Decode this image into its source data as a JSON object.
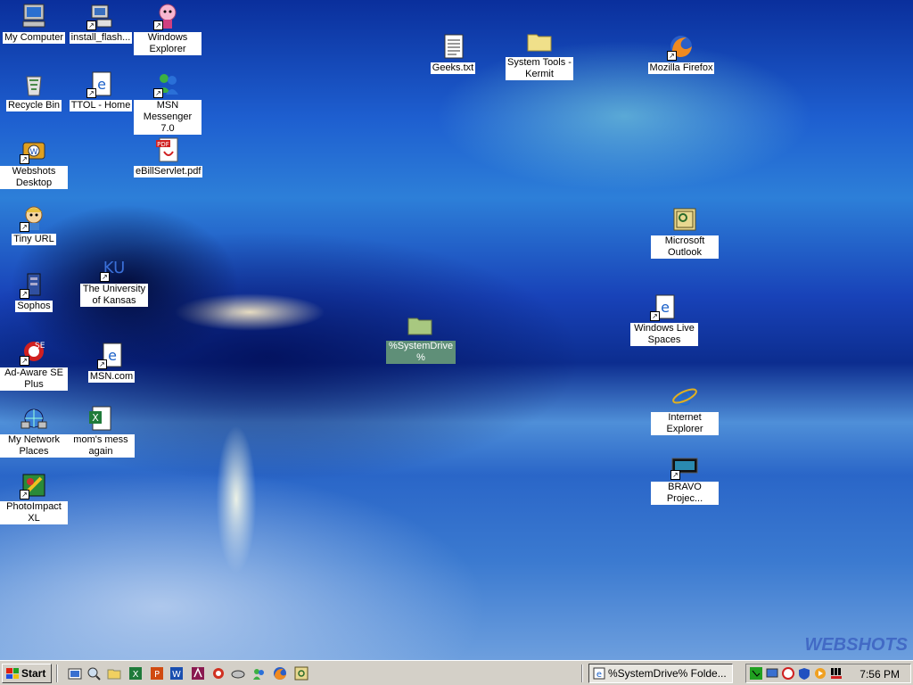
{
  "desktop": {
    "watermark": "WEBSHOTS",
    "icons": [
      {
        "label": "My Computer"
      },
      {
        "label": "install_flash..."
      },
      {
        "label": "Windows Explorer"
      },
      {
        "label": "Recycle Bin"
      },
      {
        "label": "TTOL - Home"
      },
      {
        "label": "MSN Messenger 7.0"
      },
      {
        "label": "eBillServlet.pdf"
      },
      {
        "label": "Webshots Desktop"
      },
      {
        "label": "Tiny URL"
      },
      {
        "label": "Sophos"
      },
      {
        "label": "The University of Kansas"
      },
      {
        "label": "Ad-Aware SE Plus"
      },
      {
        "label": "MSN.com"
      },
      {
        "label": "My Network Places"
      },
      {
        "label": "mom's mess again"
      },
      {
        "label": "PhotoImpact XL"
      },
      {
        "label": "Geeks.txt"
      },
      {
        "label": "System Tools - Kermit"
      },
      {
        "label": "Mozilla Firefox"
      },
      {
        "label": "%SystemDrive%"
      },
      {
        "label": "Microsoft Outlook"
      },
      {
        "label": "Windows Live Spaces"
      },
      {
        "label": "Internet Explorer"
      },
      {
        "label": "BRAVO Projec..."
      }
    ]
  },
  "taskbar": {
    "start_label": "Start",
    "active_task": "%SystemDrive% Folde...",
    "clock": "7:56 PM"
  },
  "colors": {
    "selection": "#5f8f78",
    "taskbar": "#d4d0c8"
  }
}
